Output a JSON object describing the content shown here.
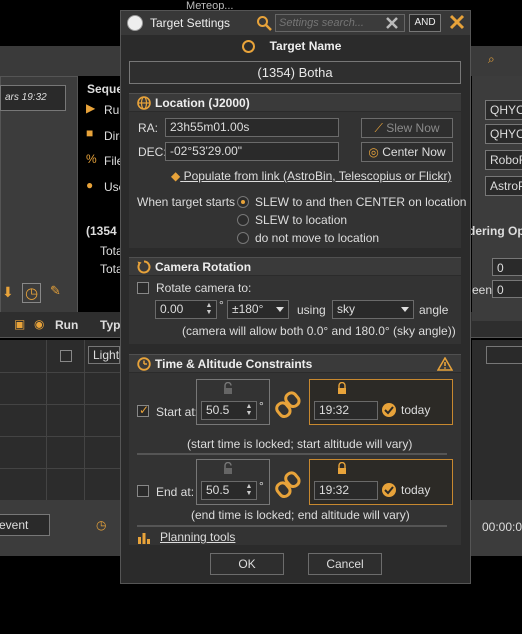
{
  "background": {
    "top_label": "Метеор...",
    "timestamp": "ars 19:32",
    "seq_header": "Seque",
    "seq_items": [
      "Ru",
      "Dire",
      "File",
      "Use"
    ],
    "target_short": "(1354",
    "totals": [
      "Tota",
      "Tota"
    ],
    "grid_header_run": "Run",
    "grid_header_type": "Typ",
    "light_option": "Light",
    "bottom_select": "event",
    "bottom_time": "00:00:00",
    "right_items": [
      "QHYC",
      "QHYC",
      "RoboF",
      "AstroP"
    ],
    "right_ordering": "dering Opt",
    "right_zero1": "0",
    "right_zero2": "0",
    "right_seen": "een:"
  },
  "dialog": {
    "title": "Target Settings",
    "search_placeholder": "Settings search...",
    "and_label": "AND"
  },
  "target": {
    "heading": "Target Name",
    "name": "(1354) Botha"
  },
  "location": {
    "heading": "Location (J2000)",
    "ra_label": "RA:",
    "ra_value": "23h55m01.00s",
    "dec_label": "DEC:",
    "dec_value": "-02°53'29.00\"",
    "slew_now": "Slew Now",
    "center_now": "Center Now",
    "populate_link": "Populate from link (AstroBin, Telescopius or Flickr)",
    "when_label": "When target starts",
    "options": [
      {
        "label": "SLEW to and then CENTER on location",
        "selected": true
      },
      {
        "label": "SLEW to location",
        "selected": false
      },
      {
        "label": "do not move to location",
        "selected": false
      }
    ]
  },
  "rotation": {
    "heading": "Camera Rotation",
    "rotate_label": "Rotate camera to:",
    "angle_value": "0.00",
    "degree_symbol": "°",
    "range_value": "±180°",
    "using_label": "using",
    "using_value": "sky",
    "angle_label": "angle",
    "note": "(camera will allow both 0.0° and 180.0° (sky angle))"
  },
  "constraints": {
    "heading": "Time & Altitude Constraints",
    "start_label": "Start at:",
    "start_checked": true,
    "start_altitude": "50.5",
    "start_time": "19:32",
    "start_day": "today",
    "start_note": "(start time is locked; start altitude will vary)",
    "end_label": "End at:",
    "end_checked": false,
    "end_altitude": "50.5",
    "end_time": "19:32",
    "end_day": "today",
    "end_note": "(end time is locked; end altitude will vary)",
    "planning_tools": "Planning tools",
    "degree_symbol": "°"
  },
  "footer": {
    "ok": "OK",
    "cancel": "Cancel"
  },
  "colors": {
    "accent": "#e8a33a",
    "background": "#2b2b2b",
    "panel": "#333333"
  }
}
